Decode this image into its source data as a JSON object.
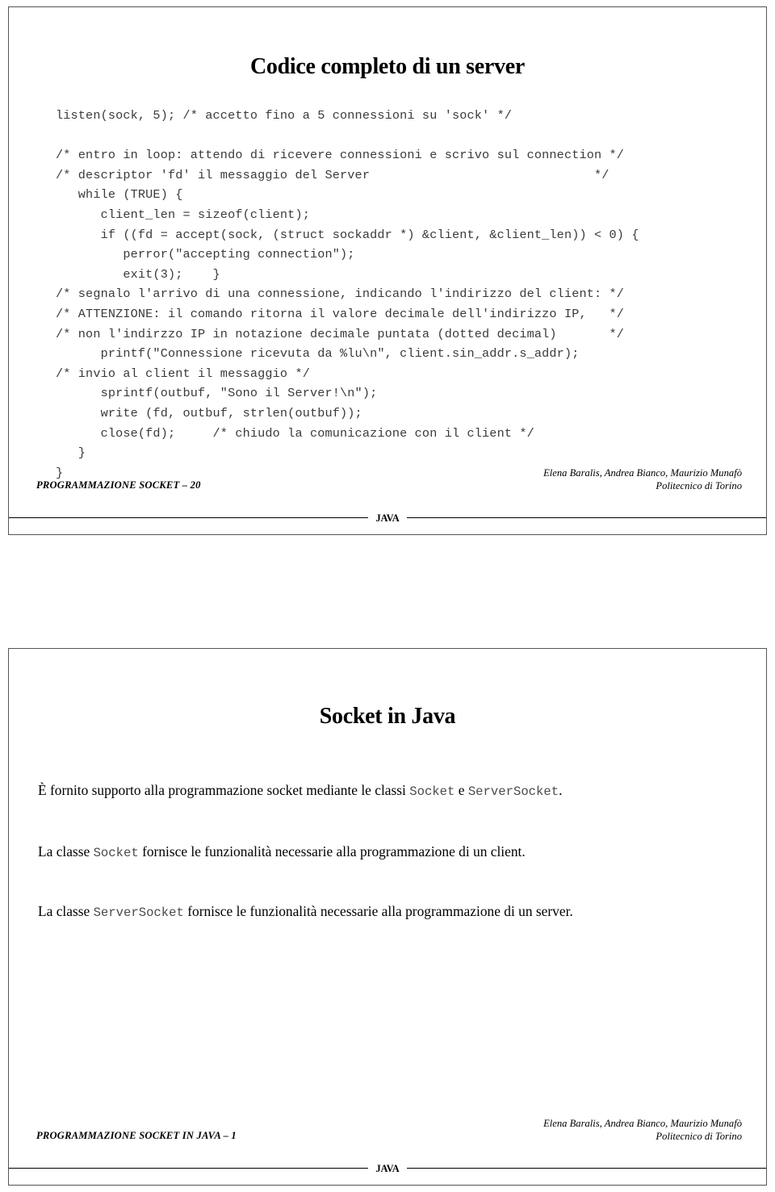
{
  "document": {
    "kind": "lecture-slides",
    "slides": [
      {
        "title": "Codice completo di un server",
        "code_lines": [
          "listen(sock, 5); /* accetto fino a 5 connessioni su 'sock' */",
          "",
          "/* entro in loop: attendo di ricevere connessioni e scrivo sul connection */",
          "/* descriptor 'fd' il messaggio del Server                              */",
          "   while (TRUE) {",
          "      client_len = sizeof(client);",
          "      if ((fd = accept(sock, (struct sockaddr *) &client, &client_len)) < 0) {",
          "         perror(\"accepting connection\");",
          "         exit(3);    }",
          "/* segnalo l'arrivo di una connessione, indicando l'indirizzo del client: */",
          "/* ATTENZIONE: il comando ritorna il valore decimale dell'indirizzo IP,   */",
          "/* non l'indirzzo IP in notazione decimale puntata (dotted decimal)       */",
          "      printf(\"Connessione ricevuta da %lu\\n\", client.sin_addr.s_addr);",
          "/* invio al client il messaggio */",
          "      sprintf(outbuf, \"Sono il Server!\\n\");",
          "      write (fd, outbuf, strlen(outbuf));",
          "      close(fd);     /* chiudo la comunicazione con il client */",
          "   }",
          "}"
        ],
        "footer": {
          "left": "PROGRAMMAZIONE SOCKET – 20",
          "authors": "Elena Baralis, Andrea Bianco, Maurizio Munafò",
          "institution": "Politecnico di Torino",
          "rule_label": "JAVA"
        }
      },
      {
        "title": "Socket in Java",
        "paragraphs": [
          {
            "parts": [
              {
                "text": "È fornito supporto alla programmazione socket mediante le classi ",
                "style": "serif"
              },
              {
                "text": "Socket",
                "style": "mono"
              },
              {
                "text": " e ",
                "style": "serif"
              },
              {
                "text": "ServerSocket",
                "style": "mono"
              },
              {
                "text": ".",
                "style": "serif"
              }
            ]
          },
          {
            "parts": [
              {
                "text": "La classe ",
                "style": "serif"
              },
              {
                "text": "Socket",
                "style": "mono"
              },
              {
                "text": " fornisce le funzionalità necessarie alla programmazione di un client.",
                "style": "serif"
              }
            ]
          },
          {
            "parts": [
              {
                "text": "La classe ",
                "style": "serif"
              },
              {
                "text": "ServerSocket",
                "style": "mono"
              },
              {
                "text": " fornisce le funzionalità necessarie alla programmazione di un server.",
                "style": "serif"
              }
            ]
          }
        ],
        "footer": {
          "left": "PROGRAMMAZIONE SOCKET IN JAVA – 1",
          "authors": "Elena Baralis, Andrea Bianco, Maurizio Munafò",
          "institution": "Politecnico di Torino",
          "rule_label": "JAVA"
        }
      }
    ]
  }
}
